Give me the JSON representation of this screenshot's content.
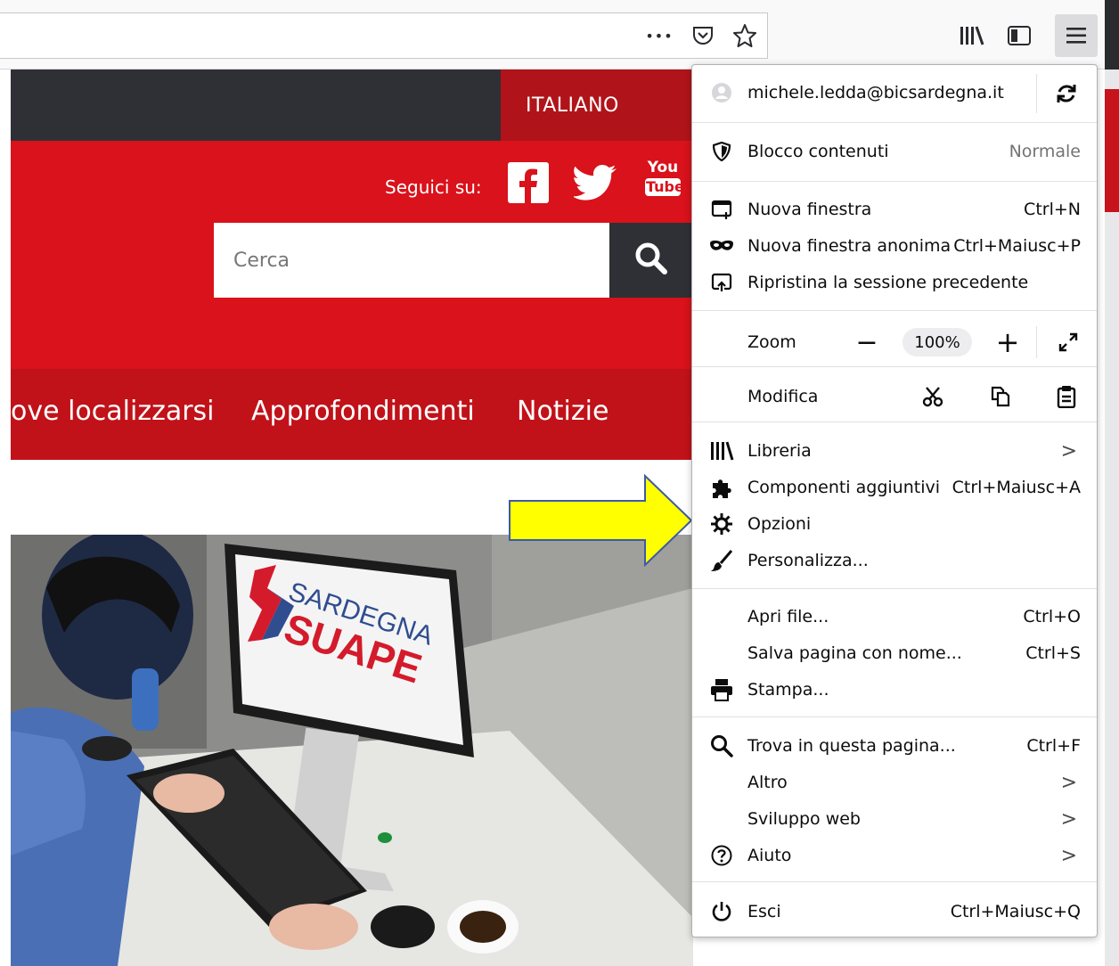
{
  "toolbar": {
    "icons": [
      "more-icon",
      "pocket-icon",
      "bookmark-star-icon",
      "library-icon",
      "sidebar-icon",
      "hamburger-menu-icon"
    ],
    "more_glyph": "•••"
  },
  "site": {
    "language": "ITALIANO",
    "follow_label": "Seguici su:",
    "youtube_top": "You",
    "youtube_bottom": "Tube",
    "search_placeholder": "Cerca",
    "nav": [
      "ove localizzarsi",
      "Approfondimenti",
      "Notizie"
    ],
    "photo_logo_line1": "SARDEGNA",
    "photo_logo_line2": "SUAPE",
    "accent_red": "#d9121b",
    "dark": "#2f3035"
  },
  "menu": {
    "account_email": "michele.ledda@bicsardegna.it",
    "content_blocking": {
      "label": "Blocco contenuti",
      "value": "Normale"
    },
    "new_window": {
      "label": "Nuova finestra",
      "shortcut": "Ctrl+N"
    },
    "private_window": {
      "label": "Nuova finestra anonima",
      "shortcut": "Ctrl+Maiusc+P"
    },
    "restore_session": {
      "label": "Ripristina la sessione precedente"
    },
    "zoom": {
      "label": "Zoom",
      "minus": "−",
      "value": "100%",
      "plus": "+"
    },
    "edit": {
      "label": "Modifica"
    },
    "library": {
      "label": "Libreria",
      "chevron": ">"
    },
    "addons": {
      "label": "Componenti aggiuntivi",
      "shortcut": "Ctrl+Maiusc+A"
    },
    "options": {
      "label": "Opzioni"
    },
    "customize": {
      "label": "Personalizza..."
    },
    "open_file": {
      "label": "Apri file...",
      "shortcut": "Ctrl+O"
    },
    "save_page": {
      "label": "Salva pagina con nome...",
      "shortcut": "Ctrl+S"
    },
    "print": {
      "label": "Stampa..."
    },
    "find": {
      "label": "Trova in questa pagina...",
      "shortcut": "Ctrl+F"
    },
    "more": {
      "label": "Altro",
      "chevron": ">"
    },
    "web_dev": {
      "label": "Sviluppo web",
      "chevron": ">"
    },
    "help": {
      "label": "Aiuto",
      "chevron": ">"
    },
    "exit": {
      "label": "Esci",
      "shortcut": "Ctrl+Maiusc+Q"
    }
  },
  "annotation": {
    "arrow_color": "#ffff00",
    "arrow_border": "#3b5ba5"
  }
}
